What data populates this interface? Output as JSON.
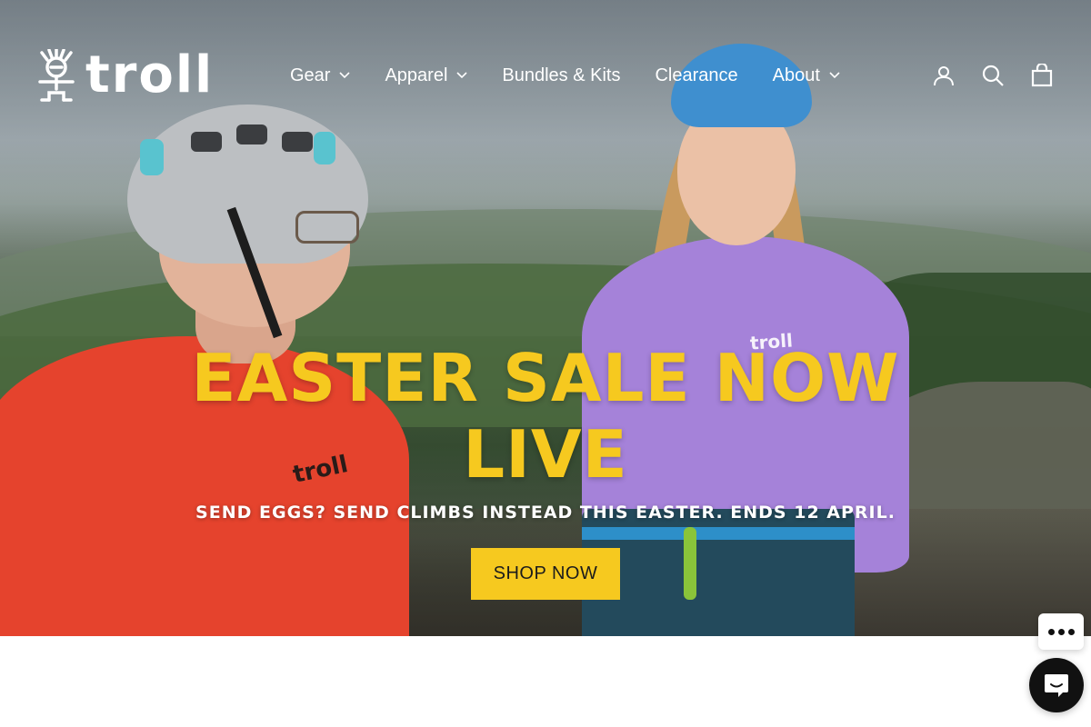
{
  "brand": {
    "name": "troll",
    "logo_icon": "troll-figure-icon"
  },
  "nav": {
    "items": [
      {
        "label": "Gear",
        "has_dropdown": true
      },
      {
        "label": "Apparel",
        "has_dropdown": true
      },
      {
        "label": "Bundles & Kits",
        "has_dropdown": false
      },
      {
        "label": "Clearance",
        "has_dropdown": false
      },
      {
        "label": "About",
        "has_dropdown": true
      }
    ]
  },
  "header_icons": [
    "account-icon",
    "search-icon",
    "cart-icon"
  ],
  "hero": {
    "headline_line1": "EASTER SALE NOW",
    "headline_line2": "LIVE",
    "subline": "SEND EGGS? SEND CLIMBS INSTEAD THIS EASTER. ENDS 12 APRIL.",
    "cta_label": "SHOP NOW",
    "shirt_logo_text": "troll"
  },
  "colors": {
    "accent_yellow": "#f6c91f",
    "text_white": "#ffffff",
    "chat_dark": "#111111"
  },
  "chat": {
    "more_icon": "more-dots-icon",
    "launcher_icon": "chat-bubble-icon"
  }
}
